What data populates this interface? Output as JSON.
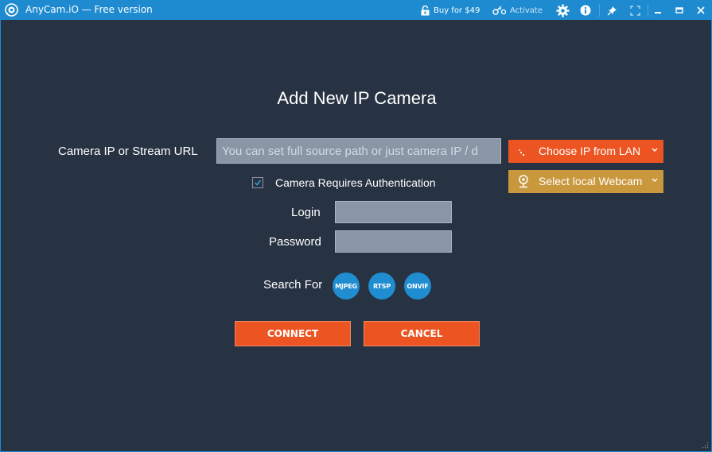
{
  "window": {
    "title": "AnyCam.iO — Free version",
    "accent": "#1e8bd1",
    "background": "#273242"
  },
  "toolbar": {
    "buy_label": "Buy for $49",
    "activate_label": "Activate",
    "icons": [
      "settings-icon",
      "info-icon",
      "pin-icon",
      "fullscreen-icon",
      "minimize-icon",
      "maximize-icon",
      "close-icon"
    ]
  },
  "form": {
    "heading": "Add New IP Camera",
    "url_label": "Camera IP or Stream URL",
    "url_value": "",
    "url_placeholder": "You can set full source path or just camera IP / d",
    "choose_ip_label": "Choose IP from LAN",
    "webcam_label": "Select local Webcam",
    "auth_label": "Camera Requires Authentication",
    "auth_checked": true,
    "login_label": "Login",
    "login_value": "",
    "password_label": "Password",
    "password_value": "",
    "search_label": "Search For",
    "search_options": [
      "MJPEG",
      "RTSP",
      "ONVIF"
    ],
    "connect_label": "CONNECT",
    "cancel_label": "CANCEL"
  },
  "colors": {
    "primary_button": "#ec5522",
    "webcam_button": "#c9973c",
    "search_pill": "#1f8dd0"
  }
}
